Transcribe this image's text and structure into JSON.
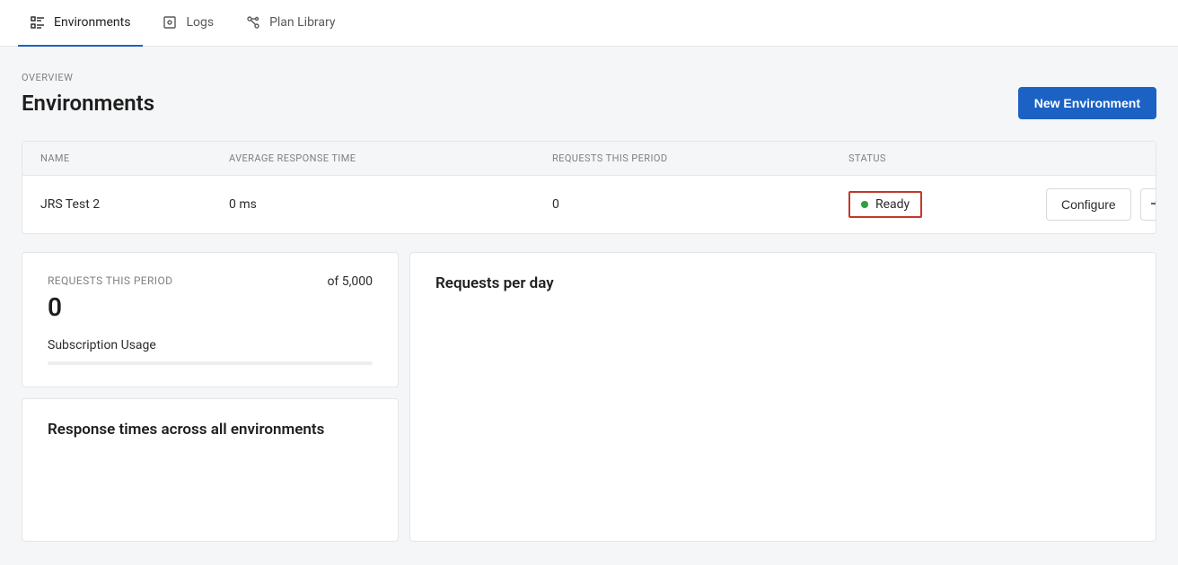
{
  "tabs": {
    "environments": "Environments",
    "logs": "Logs",
    "plan_library": "Plan Library"
  },
  "page": {
    "overview_label": "OVERVIEW",
    "title": "Environments",
    "new_env_button": "New Environment"
  },
  "table": {
    "headers": {
      "name": "NAME",
      "avg_response": "AVERAGE RESPONSE TIME",
      "requests": "REQUESTS THIS PERIOD",
      "status": "STATUS"
    },
    "row": {
      "name": "JRS Test 2",
      "avg_response": "0 ms",
      "requests": "0",
      "status": "Ready",
      "configure": "Configure"
    }
  },
  "metric_card": {
    "label": "REQUESTS THIS PERIOD",
    "of_text": "of 5,000",
    "value": "0",
    "sub_label": "Subscription Usage"
  },
  "response_card": {
    "title": "Response times across all environments"
  },
  "requests_card": {
    "title": "Requests per day"
  }
}
